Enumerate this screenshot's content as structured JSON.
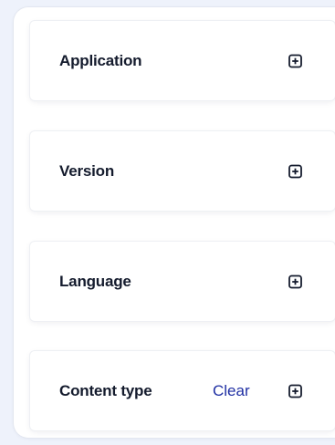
{
  "filters": {
    "sections": [
      {
        "label": "Application",
        "icon": "plus-square-icon"
      },
      {
        "label": "Version",
        "icon": "plus-square-icon"
      },
      {
        "label": "Language",
        "icon": "plus-square-icon"
      },
      {
        "label": "Content type",
        "clear_label": "Clear",
        "icon": "plus-square-icon"
      }
    ]
  },
  "colors": {
    "page_background": "#eef2fb",
    "title_text": "#141b2d",
    "link_text": "#1f2fa3"
  }
}
